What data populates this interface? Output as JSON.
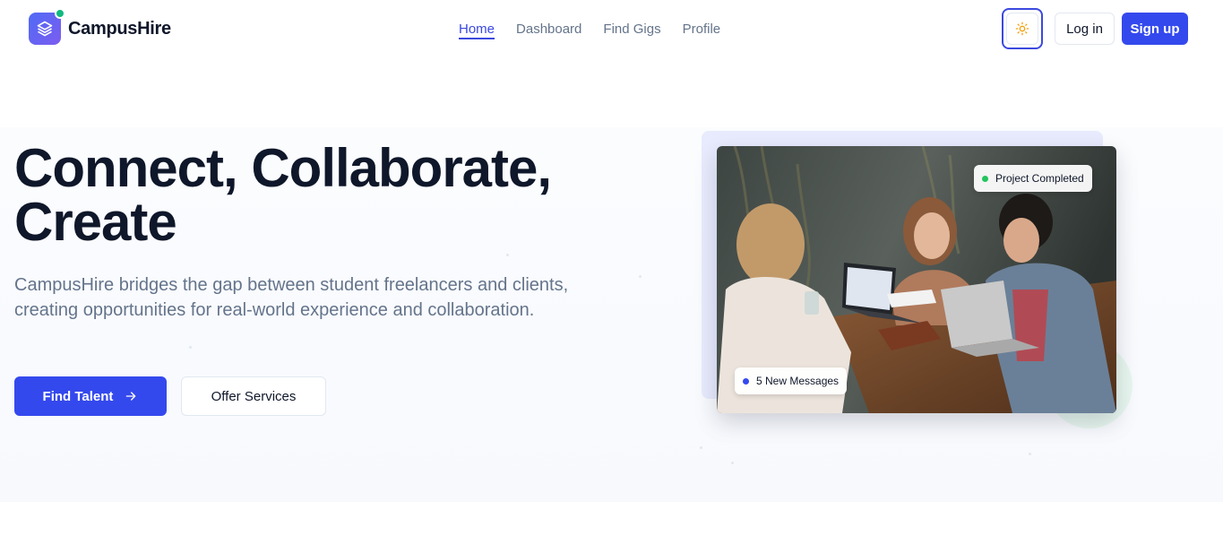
{
  "brand": {
    "name": "CampusHire"
  },
  "nav": {
    "items": [
      {
        "label": "Home",
        "active": true
      },
      {
        "label": "Dashboard",
        "active": false
      },
      {
        "label": "Find Gigs",
        "active": false
      },
      {
        "label": "Profile",
        "active": false
      }
    ]
  },
  "header_actions": {
    "theme_icon": "sun-icon",
    "login_label": "Log in",
    "signup_label": "Sign up"
  },
  "hero": {
    "title_line1": "Connect, Collaborate,",
    "title_line2": "Create",
    "subtitle": "CampusHire bridges the gap between student freelancers and clients, creating opportunities for real-world experience and collaboration.",
    "primary_cta": "Find Talent",
    "primary_cta_icon": "arrow-right-icon",
    "secondary_cta": "Offer Services"
  },
  "image_card": {
    "badge_top": {
      "label": "Project Completed",
      "dot_color": "#22c55e"
    },
    "badge_bottom": {
      "label": "5 New Messages",
      "dot_color": "#3449ed"
    }
  },
  "colors": {
    "accent": "#3449ed",
    "text_dark": "#0f172a",
    "text_muted": "#64748b",
    "success": "#22c55e"
  }
}
